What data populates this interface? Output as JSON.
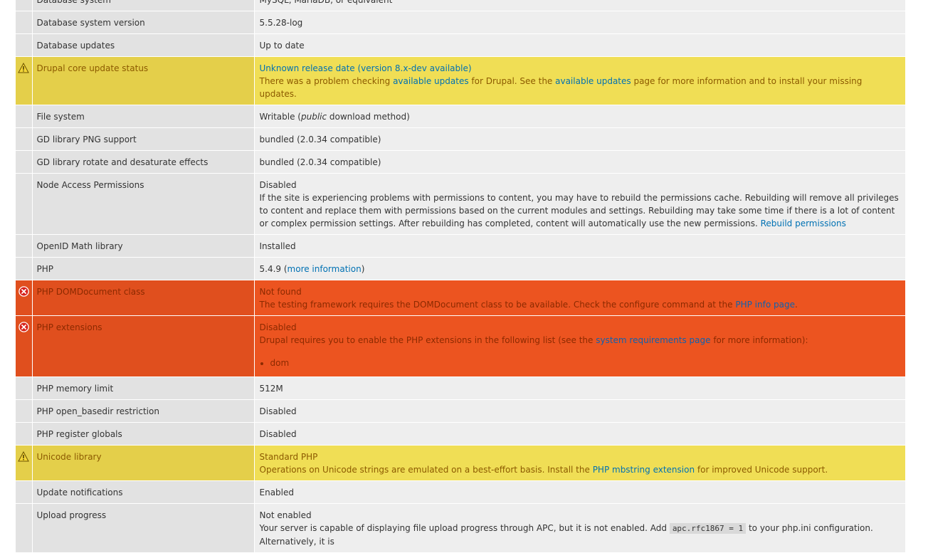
{
  "rows": [
    {
      "status": "ok",
      "title": "Database system",
      "value": "MySQL, MariaDB, or equivalent"
    },
    {
      "status": "ok",
      "title": "Database system version",
      "value": "5.5.28-log"
    },
    {
      "status": "ok",
      "title": "Database updates",
      "value": "Up to date"
    },
    {
      "status": "warning",
      "title": "Drupal core update status",
      "value_link": "Unknown release date (version 8.x-dev available)",
      "desc_part1": "There was a problem checking ",
      "desc_link1": "available updates",
      "desc_part2": " for Drupal. See the ",
      "desc_link2": "available updates",
      "desc_part3": " page for more information and to install your missing updates."
    },
    {
      "status": "ok",
      "title": "File system",
      "value_part1": "Writable (",
      "value_em": "public",
      "value_part2": " download method)"
    },
    {
      "status": "ok",
      "title": "GD library PNG support",
      "value": "bundled (2.0.34 compatible)"
    },
    {
      "status": "ok",
      "title": "GD library rotate and desaturate effects",
      "value": "bundled (2.0.34 compatible)"
    },
    {
      "status": "ok",
      "title": "Node Access Permissions",
      "value": "Disabled",
      "desc": "If the site is experiencing problems with permissions to content, you may have to rebuild the permissions cache. Rebuilding will remove all privileges to content and replace them with permissions based on the current modules and settings. Rebuilding may take some time if there is a lot of content or complex permission settings. After rebuilding has completed, content will automatically use the new permissions. ",
      "desc_link": "Rebuild permissions"
    },
    {
      "status": "ok",
      "title": "OpenID Math library",
      "value": "Installed"
    },
    {
      "status": "ok",
      "title": "PHP",
      "value_part1": "5.4.9 (",
      "value_link": "more information",
      "value_part2": ")"
    },
    {
      "status": "error",
      "title": "PHP DOMDocument class",
      "value": "Not found",
      "desc_part1": "The testing framework requires the DOMDocument class to be available. Check the configure command at the ",
      "desc_link": "PHP info page",
      "desc_part2": "."
    },
    {
      "status": "error",
      "title": "PHP extensions",
      "value": "Disabled",
      "desc_part1": "Drupal requires you to enable the PHP extensions in the following list (see the ",
      "desc_link": "system requirements page",
      "desc_part2": " for more information):",
      "list": [
        "dom"
      ]
    },
    {
      "status": "ok",
      "title": "PHP memory limit",
      "value": "512M"
    },
    {
      "status": "ok",
      "title": "PHP open_basedir restriction",
      "value": "Disabled"
    },
    {
      "status": "ok",
      "title": "PHP register globals",
      "value": "Disabled"
    },
    {
      "status": "warning",
      "title": "Unicode library",
      "value": "Standard PHP",
      "desc_part1": "Operations on Unicode strings are emulated on a best-effort basis. Install the ",
      "desc_link": "PHP mbstring extension",
      "desc_part2": " for improved Unicode support."
    },
    {
      "status": "ok",
      "title": "Update notifications",
      "value": "Enabled"
    },
    {
      "status": "ok",
      "title": "Upload progress",
      "value": "Not enabled",
      "desc_part1": "Your server is capable of displaying file upload progress through APC, but it is not enabled. Add ",
      "desc_code": "apc.rfc1867 = 1",
      "desc_part2": " to your php.ini configuration. Alternatively, it is"
    }
  ],
  "icons": {
    "warning": "warning-triangle-icon",
    "error": "error-circle-x-icon"
  },
  "colors": {
    "ok_title": "#e2e2e2",
    "ok_value": "#eeeeee",
    "warning": "#f0de55",
    "error": "#ec5420",
    "link": "#0071b3"
  }
}
